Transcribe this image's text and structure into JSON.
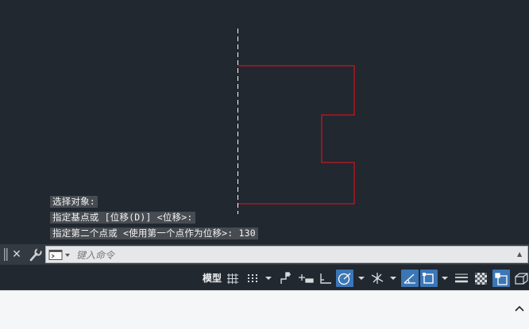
{
  "command_history": [
    "选择对象:",
    "指定基点或 [位移(D)] <位移>:",
    "指定第二个点或 <使用第一个点作为位移>:  130"
  ],
  "command_line": {
    "placeholder": "键入命令",
    "value": ""
  },
  "status_bar": {
    "model_tab_label": "模型"
  },
  "colors": {
    "canvas_background": "#212830",
    "geometry_stroke": "#c8141e",
    "dashed_line": "#ffffff",
    "toggle_active": "#3c76b6"
  },
  "icons": {
    "command_bar": [
      "grip-icon",
      "close-icon",
      "customize-wrench-icon",
      "command-prompt-icon",
      "recent-commands-chevron-icon"
    ],
    "status_bar": [
      "grid-icon",
      "snap-mode-icon",
      "infer-constraints-icon",
      "dynamic-input-icon",
      "ortho-icon",
      "polar-tracking-icon",
      "isometric-drafting-icon",
      "object-snap-tracking-icon",
      "object-snap-icon",
      "lineweight-icon",
      "transparency-icon",
      "selection-cycling-icon",
      "3d-object-snap-icon"
    ],
    "ribbon": [
      "chevron-up-icon"
    ]
  }
}
